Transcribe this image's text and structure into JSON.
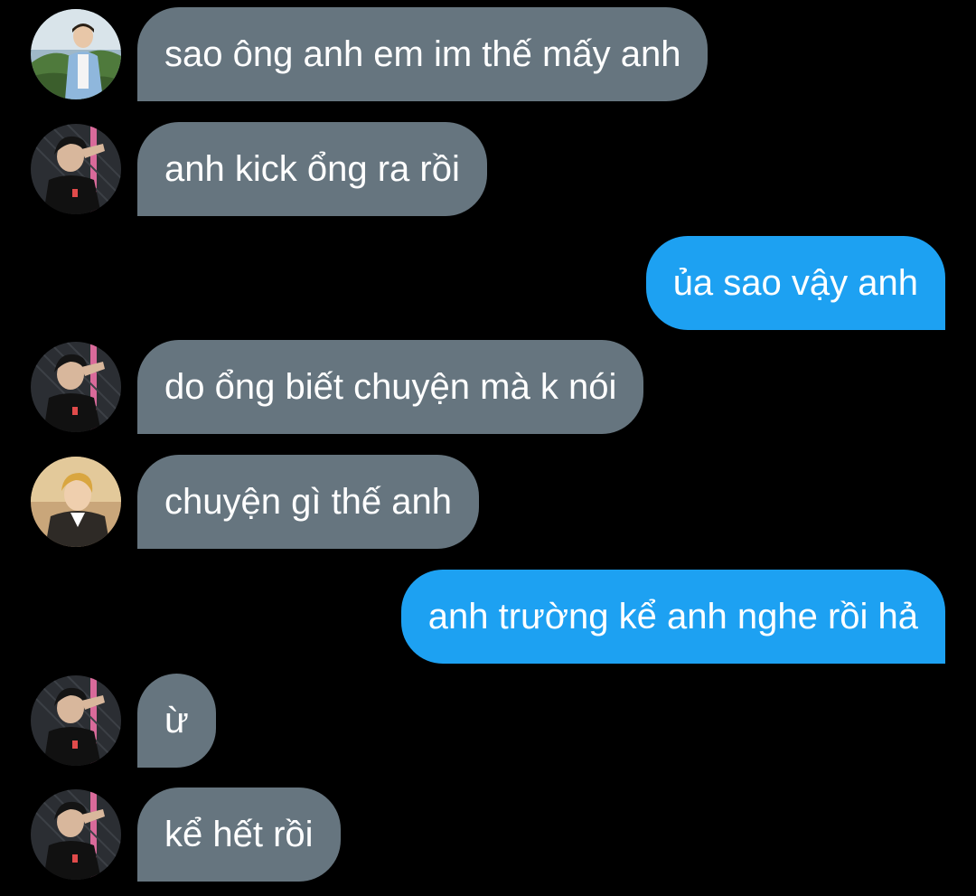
{
  "colors": {
    "background": "#000000",
    "incoming_bubble": "#66757f",
    "outgoing_bubble": "#1da1f2",
    "text": "#ffffff"
  },
  "messages": [
    {
      "side": "left",
      "avatar": "avatar-user-a",
      "text": "sao ông anh em im thế mấy anh"
    },
    {
      "side": "left",
      "avatar": "avatar-user-b",
      "text": "anh kick ổng ra rồi"
    },
    {
      "side": "right",
      "text": "ủa sao vậy anh"
    },
    {
      "side": "left",
      "avatar": "avatar-user-b",
      "text": "do ổng biết chuyện mà k nói"
    },
    {
      "side": "left",
      "avatar": "avatar-user-c",
      "text": "chuyện gì thế anh"
    },
    {
      "side": "right",
      "text": "anh trường kể anh nghe rồi hả"
    },
    {
      "side": "left",
      "avatar": "avatar-user-b",
      "text": "ừ"
    },
    {
      "side": "left",
      "avatar": "avatar-user-b",
      "text": "kể hết rồi"
    }
  ]
}
